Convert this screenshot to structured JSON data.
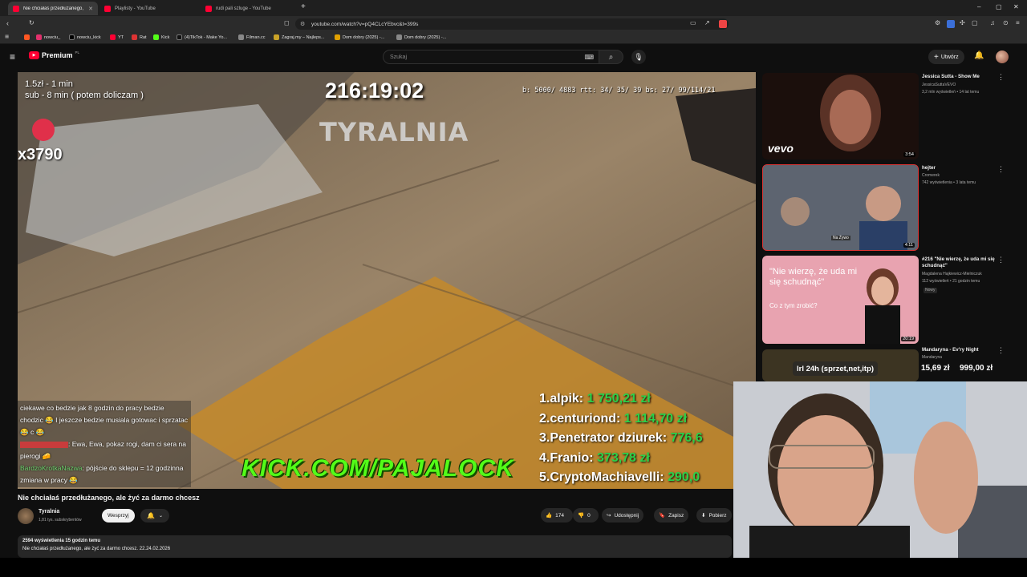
{
  "tabs": [
    {
      "title": "Nie chciałaś przedłużanego, a",
      "active": true
    },
    {
      "title": "Playlisty - YouTube",
      "active": false
    },
    {
      "title": "rudi pali szluge - YouTube",
      "active": false
    }
  ],
  "new_tab": "+",
  "window_controls": {
    "minimize": "–",
    "maximize": "▢",
    "close": "✕"
  },
  "url": "youtube.com/watch?v=pQ4CLcYEbvc&t=399s",
  "bookmarks": [
    "nowciu_",
    "nowciu_kick",
    "YT",
    "Rat",
    "Kick",
    "(4)TikTok - Make Yo...",
    "Filman.cc",
    "Zagraj.my – Najleps...",
    "Dom dobry (2025) -...",
    "Dom dobry (2025) -..."
  ],
  "yt_header": {
    "logo": "Premium",
    "country": "PL",
    "search_placeholder": "Szukaj",
    "create_label": "Utwórz"
  },
  "stream_overlay": {
    "price_line1": "1.5zł - 1 min",
    "price_line2": "sub - 8 min ( potem doliczam )",
    "timer": "216:19:02",
    "channel_logo": "TYRALNIA",
    "stats": "b:  5000/ 4883  rtt:   34/  35/  39  bs:   27/  99/114/21",
    "counter": "x3790",
    "kick_url": "KICK.COM/PAJALOCK",
    "chat": [
      {
        "user": "",
        "text": "ciekawe co bedzie jak 8 godzin do pracy bedzie chodzic 😂 I jeszcze bedzie musiala gotowac i sprzatac 😂 c 😂"
      },
      {
        "user": "",
        "text": ": Ewa, Ewa, pokaz rogi, dam ci sera na pierogi 🧀"
      },
      {
        "user": "BardzoKrotkaNazwa",
        "text": ": pójście do sklepu = 12 godzinna zmiana w pracy 😂"
      }
    ],
    "leaderboard": [
      {
        "rank": "1.",
        "name": "alpik:",
        "amount": "1 750,21 zł"
      },
      {
        "rank": "2.",
        "name": "centuriond:",
        "amount": "1 114,70 zł"
      },
      {
        "rank": "3.",
        "name": "Penetrator dziurek:",
        "amount": "776,6"
      },
      {
        "rank": "4.",
        "name": "Franio:",
        "amount": "373,78 zł"
      },
      {
        "rank": "5.",
        "name": "CryptoMachiavelli:",
        "amount": "290,0"
      }
    ]
  },
  "video": {
    "title": "Nie chciałaś przedłużanego, ale żyć za darmo chcesz",
    "channel": "Tyralnia",
    "subscribers": "1,81 tys. subskrybentów",
    "support_label": "Wesprzyj",
    "likes": "174",
    "dislikes": "0",
    "share_label": "Udostępnij",
    "save_label": "Zapisz",
    "download_label": "Pobierz",
    "views_line": "2594 wyświetlenia  15 godzin temu",
    "desc_line": "Nie chciałaś przedłużanego, ale żyć za darmo chcesz. 22.24.02.2026"
  },
  "sidebar": [
    {
      "title": "Jessica Sutta - Show Me",
      "channel": "JessicaSuttaVEVO",
      "meta": "3,2 mln wyświetleń • 14 lat temu",
      "duration": "3:54",
      "thumb_text": "vevo"
    },
    {
      "title": "hejter",
      "channel": "Cromerek",
      "meta": "742 wyświetlenia • 3 lata temu",
      "duration": "4:11",
      "thumb_text": "Na Żywo"
    },
    {
      "title": "#216 \"Nie wierzę, że uda mi się schudnąć\"",
      "channel": "Magdalena Hajkiewicz-Mielniczuk",
      "meta": "112 wyświetleń • 21 godzin temu",
      "badge": "Nowy",
      "duration": "20:19",
      "thumb_text": "\"Nie wierzę, że uda mi się schudnąć\"",
      "thumb_sub": "Co z tym zrobić?"
    },
    {
      "title": "Mandaryna - Ev'ry Night",
      "channel": "Mandaryna",
      "meta": "",
      "duration": "",
      "thumb_text": ""
    }
  ],
  "ticker": {
    "label": "lrl 24h (sprzet,net,itp)",
    "amount1": "15,69 zł",
    "amount2": "999,00 zł"
  },
  "colors": {
    "yt_red": "#ff0033",
    "donation_green": "#2bd14a",
    "kick_green": "#53fc18",
    "bg": "#0f0f0f"
  }
}
